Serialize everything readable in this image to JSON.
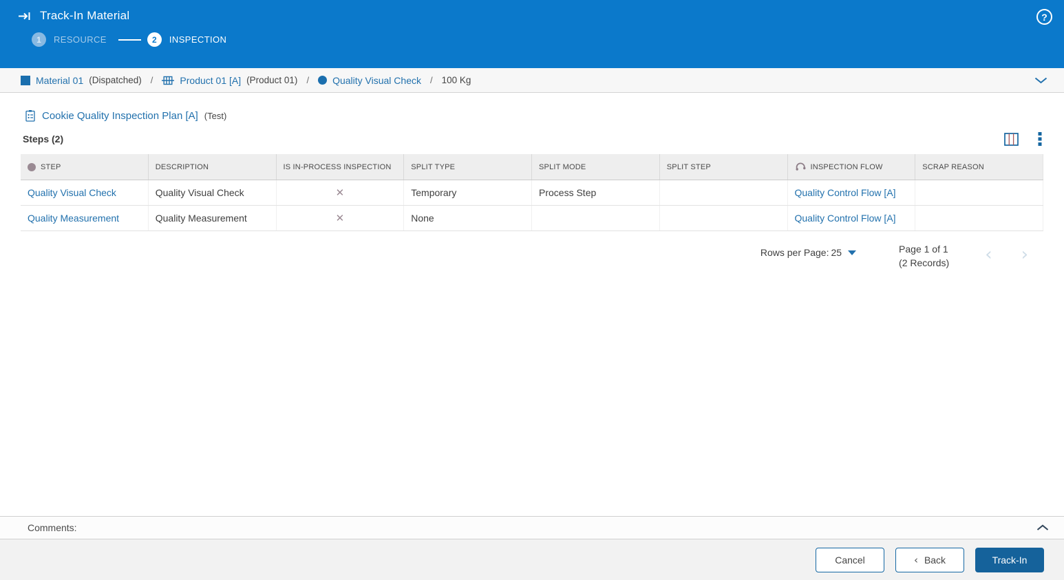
{
  "header": {
    "title": "Track-In Material",
    "steps": [
      {
        "number": "1",
        "label": "RESOURCE",
        "state": "completed"
      },
      {
        "number": "2",
        "label": "INSPECTION",
        "state": "active"
      }
    ],
    "help_icon": "help-circle"
  },
  "breadcrumb": {
    "separator": "/",
    "items": [
      {
        "icon": "material-square-icon",
        "link": "Material 01",
        "annotation": "(Dispatched)"
      },
      {
        "icon": "product-icon",
        "link": "Product 01 [A]",
        "annotation": "(Product 01)"
      },
      {
        "icon": "step-circle-icon",
        "link": "Quality Visual Check",
        "annotation": ""
      }
    ],
    "quantity": "100 Kg"
  },
  "plan": {
    "icon": "inspection-plan-icon",
    "title": "Cookie Quality Inspection Plan [A]",
    "subtitle": "(Test)"
  },
  "steps_section": {
    "title": "Steps (2)",
    "tools": [
      "columns-icon",
      "kebab-menu-icon"
    ]
  },
  "table": {
    "columns": [
      "STEP",
      "DESCRIPTION",
      "IS IN-PROCESS INSPECTION",
      "SPLIT TYPE",
      "SPLIT MODE",
      "SPLIT STEP",
      "INSPECTION FLOW",
      "SCRAP REASON"
    ],
    "rows": [
      {
        "step": "Quality Visual Check",
        "description": "Quality Visual Check",
        "is_in_process_mark": "✕",
        "split_type": "Temporary",
        "split_mode": "Process Step",
        "split_step": "",
        "inspection_flow": "Quality Control Flow [A]",
        "scrap_reason": ""
      },
      {
        "step": "Quality Measurement",
        "description": "Quality Measurement",
        "is_in_process_mark": "✕",
        "split_type": "None",
        "split_mode": "",
        "split_step": "",
        "inspection_flow": "Quality Control Flow [A]",
        "scrap_reason": ""
      }
    ]
  },
  "pagination": {
    "rows_per_page_label": "Rows per Page:",
    "rows_per_page_value": "25",
    "page_info": "Page 1 of 1",
    "records_info": "(2 Records)",
    "prev_icon": "‹",
    "next_icon": "›"
  },
  "comments": {
    "label": "Comments:"
  },
  "footer": {
    "cancel_label": "Cancel",
    "back_chevron": "‹",
    "back_label": "Back",
    "track_in_label": "Track-In"
  },
  "colors": {
    "header_blue": "#0b79cb",
    "link_blue": "#2271ad",
    "primary_button_blue": "#15629b",
    "button_border_blue": "#1467a3",
    "mauve_icon": "#9b8a94",
    "table_header_bg": "#eeeeee",
    "footer_bg": "#f2f2f2"
  }
}
